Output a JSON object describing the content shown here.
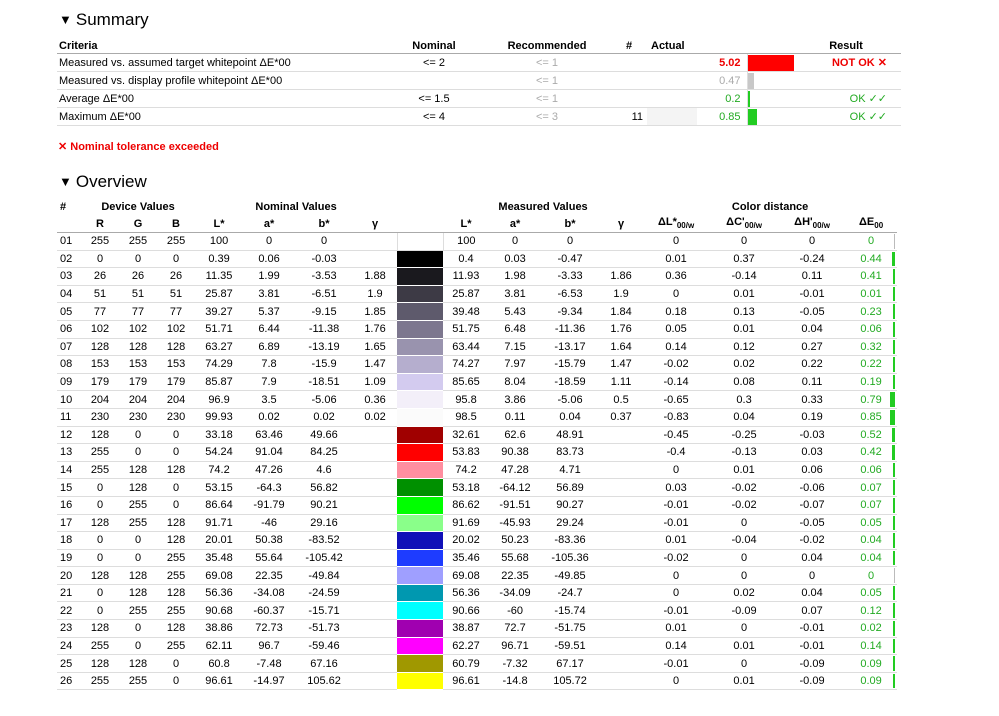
{
  "summary": {
    "title": "Summary",
    "headers": {
      "criteria": "Criteria",
      "nominal": "Nominal",
      "recommended": "Recommended",
      "count": "#",
      "actual": "Actual",
      "result": "Result"
    },
    "rows": [
      {
        "criteria": "Measured vs. assumed target whitepoint ΔE*00",
        "nominal": "<= 2",
        "recommended": "<= 1",
        "count": "",
        "actual": "5.02",
        "actual_status": "bad",
        "bar_fraction": 1.0,
        "bar_color": "#ff0000",
        "result": "NOT OK ✕",
        "result_status": "bad"
      },
      {
        "criteria": "Measured vs. display profile whitepoint ΔE*00",
        "nominal": "",
        "recommended": "<= 1",
        "count": "",
        "actual": "0.47",
        "actual_status": "gray",
        "bar_fraction": 0.12,
        "bar_color": "#c8c8c8",
        "result": "",
        "result_status": ""
      },
      {
        "criteria": "Average ΔE*00",
        "nominal": "<= 1.5",
        "recommended": "<= 1",
        "count": "",
        "actual": "0.2",
        "actual_status": "ok",
        "bar_fraction": 0.05,
        "bar_color": "#22cc22",
        "result": "OK ✓✓",
        "result_status": "ok"
      },
      {
        "criteria": "Maximum ΔE*00",
        "nominal": "<= 4",
        "recommended": "<= 3",
        "count": "11",
        "actual": "0.85",
        "actual_status": "ok",
        "bar_fraction": 0.2,
        "bar_color": "#22cc22",
        "result": "OK ✓✓",
        "result_status": "ok"
      }
    ],
    "warning": "✕ Nominal tolerance exceeded"
  },
  "overview": {
    "title": "Overview",
    "group_headers": {
      "num": "#",
      "device": "Device Values",
      "nominal": "Nominal Values",
      "measured": "Measured Values",
      "distance": "Color distance"
    },
    "col_headers": [
      "R",
      "G",
      "B",
      "L*",
      "a*",
      "b*",
      "γ",
      "L*",
      "a*",
      "b*",
      "γ"
    ],
    "distance_headers": {
      "dl_main": "ΔL*",
      "dc_main": "ΔC'",
      "dh_main": "ΔH'",
      "sub": "00/w",
      "de_main": "ΔE",
      "de_sub": "00"
    },
    "rows": [
      {
        "n": "01",
        "r": "255",
        "g": "255",
        "b": "255",
        "nl": "100",
        "na": "0",
        "nb": "0",
        "ng": "",
        "sw": "#ffffff",
        "ml": "100",
        "ma": "0",
        "mb": "0",
        "mg": "",
        "dl": "0",
        "dc": "0",
        "dh": "0",
        "de": "0",
        "dev": 0
      },
      {
        "n": "02",
        "r": "0",
        "g": "0",
        "b": "0",
        "nl": "0.39",
        "na": "0.06",
        "nb": "-0.03",
        "ng": "",
        "sw": "#000000",
        "ml": "0.4",
        "ma": "0.03",
        "mb": "-0.47",
        "mg": "",
        "dl": "0.01",
        "dc": "0.37",
        "dh": "-0.24",
        "de": "0.44",
        "dev": 0.44
      },
      {
        "n": "03",
        "r": "26",
        "g": "26",
        "b": "26",
        "nl": "11.35",
        "na": "1.99",
        "nb": "-3.53",
        "ng": "1.88",
        "sw": "#1a191e",
        "ml": "11.93",
        "ma": "1.98",
        "mb": "-3.33",
        "mg": "1.86",
        "dl": "0.36",
        "dc": "-0.14",
        "dh": "0.11",
        "de": "0.41",
        "dev": 0.41
      },
      {
        "n": "04",
        "r": "51",
        "g": "51",
        "b": "51",
        "nl": "25.87",
        "na": "3.81",
        "nb": "-6.51",
        "ng": "1.9",
        "sw": "#3d3a45",
        "ml": "25.87",
        "ma": "3.81",
        "mb": "-6.53",
        "mg": "1.9",
        "dl": "0",
        "dc": "0.01",
        "dh": "-0.01",
        "de": "0.01",
        "dev": 0.01
      },
      {
        "n": "05",
        "r": "77",
        "g": "77",
        "b": "77",
        "nl": "39.27",
        "na": "5.37",
        "nb": "-9.15",
        "ng": "1.85",
        "sw": "#5e5a6c",
        "ml": "39.48",
        "ma": "5.43",
        "mb": "-9.34",
        "mg": "1.84",
        "dl": "0.18",
        "dc": "0.13",
        "dh": "-0.05",
        "de": "0.23",
        "dev": 0.23
      },
      {
        "n": "06",
        "r": "102",
        "g": "102",
        "b": "102",
        "nl": "51.71",
        "na": "6.44",
        "nb": "-11.38",
        "ng": "1.76",
        "sw": "#7d778f",
        "ml": "51.75",
        "ma": "6.48",
        "mb": "-11.36",
        "mg": "1.76",
        "dl": "0.05",
        "dc": "0.01",
        "dh": "0.04",
        "de": "0.06",
        "dev": 0.06
      },
      {
        "n": "07",
        "r": "128",
        "g": "128",
        "b": "128",
        "nl": "63.27",
        "na": "6.89",
        "nb": "-13.19",
        "ng": "1.65",
        "sw": "#9993ae",
        "ml": "63.44",
        "ma": "7.15",
        "mb": "-13.17",
        "mg": "1.64",
        "dl": "0.14",
        "dc": "0.12",
        "dh": "0.27",
        "de": "0.32",
        "dev": 0.32
      },
      {
        "n": "08",
        "r": "153",
        "g": "153",
        "b": "153",
        "nl": "74.29",
        "na": "7.8",
        "nb": "-15.9",
        "ng": "1.47",
        "sw": "#b5aece",
        "ml": "74.27",
        "ma": "7.97",
        "mb": "-15.79",
        "mg": "1.47",
        "dl": "-0.02",
        "dc": "0.02",
        "dh": "0.22",
        "de": "0.22",
        "dev": 0.22
      },
      {
        "n": "09",
        "r": "179",
        "g": "179",
        "b": "179",
        "nl": "85.87",
        "na": "7.9",
        "nb": "-18.51",
        "ng": "1.09",
        "sw": "#d3cbef",
        "ml": "85.65",
        "ma": "8.04",
        "mb": "-18.59",
        "mg": "1.11",
        "dl": "-0.14",
        "dc": "0.08",
        "dh": "0.11",
        "de": "0.19",
        "dev": 0.19
      },
      {
        "n": "10",
        "r": "204",
        "g": "204",
        "b": "204",
        "nl": "96.9",
        "na": "3.5",
        "nb": "-5.06",
        "ng": "0.36",
        "sw": "#f3eff9",
        "ml": "95.8",
        "ma": "3.86",
        "mb": "-5.06",
        "mg": "0.5",
        "dl": "-0.65",
        "dc": "0.3",
        "dh": "0.33",
        "de": "0.79",
        "dev": 0.79
      },
      {
        "n": "11",
        "r": "230",
        "g": "230",
        "b": "230",
        "nl": "99.93",
        "na": "0.02",
        "nb": "0.02",
        "ng": "0.02",
        "sw": "#fbfbfb",
        "ml": "98.5",
        "ma": "0.11",
        "mb": "0.04",
        "mg": "0.37",
        "dl": "-0.83",
        "dc": "0.04",
        "dh": "0.19",
        "de": "0.85",
        "dev": 0.85
      },
      {
        "n": "12",
        "r": "128",
        "g": "0",
        "b": "0",
        "nl": "33.18",
        "na": "63.46",
        "nb": "49.66",
        "ng": "",
        "sw": "#a00000",
        "ml": "32.61",
        "ma": "62.6",
        "mb": "48.91",
        "mg": "",
        "dl": "-0.45",
        "dc": "-0.25",
        "dh": "-0.03",
        "de": "0.52",
        "dev": 0.52
      },
      {
        "n": "13",
        "r": "255",
        "g": "0",
        "b": "0",
        "nl": "54.24",
        "na": "91.04",
        "nb": "84.25",
        "ng": "",
        "sw": "#ff0000",
        "ml": "53.83",
        "ma": "90.38",
        "mb": "83.73",
        "mg": "",
        "dl": "-0.4",
        "dc": "-0.13",
        "dh": "0.03",
        "de": "0.42",
        "dev": 0.42
      },
      {
        "n": "14",
        "r": "255",
        "g": "128",
        "b": "128",
        "nl": "74.2",
        "na": "47.26",
        "nb": "4.6",
        "ng": "",
        "sw": "#ff8fa0",
        "ml": "74.2",
        "ma": "47.28",
        "mb": "4.71",
        "mg": "",
        "dl": "0",
        "dc": "0.01",
        "dh": "0.06",
        "de": "0.06",
        "dev": 0.06
      },
      {
        "n": "15",
        "r": "0",
        "g": "128",
        "b": "0",
        "nl": "53.15",
        "na": "-64.3",
        "nb": "56.82",
        "ng": "",
        "sw": "#009000",
        "ml": "53.18",
        "ma": "-64.12",
        "mb": "56.89",
        "mg": "",
        "dl": "0.03",
        "dc": "-0.02",
        "dh": "-0.06",
        "de": "0.07",
        "dev": 0.07
      },
      {
        "n": "16",
        "r": "0",
        "g": "255",
        "b": "0",
        "nl": "86.64",
        "na": "-91.79",
        "nb": "90.21",
        "ng": "",
        "sw": "#00ff00",
        "ml": "86.62",
        "ma": "-91.51",
        "mb": "90.27",
        "mg": "",
        "dl": "-0.01",
        "dc": "-0.02",
        "dh": "-0.07",
        "de": "0.07",
        "dev": 0.07
      },
      {
        "n": "17",
        "r": "128",
        "g": "255",
        "b": "128",
        "nl": "91.71",
        "na": "-46",
        "nb": "29.16",
        "ng": "",
        "sw": "#8aff8a",
        "ml": "91.69",
        "ma": "-45.93",
        "mb": "29.24",
        "mg": "",
        "dl": "-0.01",
        "dc": "0",
        "dh": "-0.05",
        "de": "0.05",
        "dev": 0.05
      },
      {
        "n": "18",
        "r": "0",
        "g": "0",
        "b": "128",
        "nl": "20.01",
        "na": "50.38",
        "nb": "-83.52",
        "ng": "",
        "sw": "#1010b8",
        "ml": "20.02",
        "ma": "50.23",
        "mb": "-83.36",
        "mg": "",
        "dl": "0.01",
        "dc": "-0.04",
        "dh": "-0.02",
        "de": "0.04",
        "dev": 0.04
      },
      {
        "n": "19",
        "r": "0",
        "g": "0",
        "b": "255",
        "nl": "35.48",
        "na": "55.64",
        "nb": "-105.42",
        "ng": "",
        "sw": "#1e3cff",
        "ml": "35.46",
        "ma": "55.68",
        "mb": "-105.36",
        "mg": "",
        "dl": "-0.02",
        "dc": "0",
        "dh": "0.04",
        "de": "0.04",
        "dev": 0.04
      },
      {
        "n": "20",
        "r": "128",
        "g": "128",
        "b": "255",
        "nl": "69.08",
        "na": "22.35",
        "nb": "-49.84",
        "ng": "",
        "sw": "#9f9fff",
        "ml": "69.08",
        "ma": "22.35",
        "mb": "-49.85",
        "mg": "",
        "dl": "0",
        "dc": "0",
        "dh": "0",
        "de": "0",
        "dev": 0
      },
      {
        "n": "21",
        "r": "0",
        "g": "128",
        "b": "128",
        "nl": "56.36",
        "na": "-34.08",
        "nb": "-24.59",
        "ng": "",
        "sw": "#0098b0",
        "ml": "56.36",
        "ma": "-34.09",
        "mb": "-24.7",
        "mg": "",
        "dl": "0",
        "dc": "0.02",
        "dh": "0.04",
        "de": "0.05",
        "dev": 0.05
      },
      {
        "n": "22",
        "r": "0",
        "g": "255",
        "b": "255",
        "nl": "90.68",
        "na": "-60.37",
        "nb": "-15.71",
        "ng": "",
        "sw": "#00ffff",
        "ml": "90.66",
        "ma": "-60",
        "mb": "-15.74",
        "mg": "",
        "dl": "-0.01",
        "dc": "-0.09",
        "dh": "0.07",
        "de": "0.12",
        "dev": 0.12
      },
      {
        "n": "23",
        "r": "128",
        "g": "0",
        "b": "128",
        "nl": "38.86",
        "na": "72.73",
        "nb": "-51.73",
        "ng": "",
        "sw": "#a000b0",
        "ml": "38.87",
        "ma": "72.7",
        "mb": "-51.75",
        "mg": "",
        "dl": "0.01",
        "dc": "0",
        "dh": "-0.01",
        "de": "0.02",
        "dev": 0.02
      },
      {
        "n": "24",
        "r": "255",
        "g": "0",
        "b": "255",
        "nl": "62.11",
        "na": "96.7",
        "nb": "-59.46",
        "ng": "",
        "sw": "#ff00ff",
        "ml": "62.27",
        "ma": "96.71",
        "mb": "-59.51",
        "mg": "",
        "dl": "0.14",
        "dc": "0.01",
        "dh": "-0.01",
        "de": "0.14",
        "dev": 0.14
      },
      {
        "n": "25",
        "r": "128",
        "g": "128",
        "b": "0",
        "nl": "60.8",
        "na": "-7.48",
        "nb": "67.16",
        "ng": "",
        "sw": "#a09800",
        "ml": "60.79",
        "ma": "-7.32",
        "mb": "67.17",
        "mg": "",
        "dl": "-0.01",
        "dc": "0",
        "dh": "-0.09",
        "de": "0.09",
        "dev": 0.09
      },
      {
        "n": "26",
        "r": "255",
        "g": "255",
        "b": "0",
        "nl": "96.61",
        "na": "-14.97",
        "nb": "105.62",
        "ng": "",
        "sw": "#ffff00",
        "ml": "96.61",
        "ma": "-14.8",
        "mb": "105.72",
        "mg": "",
        "dl": "0",
        "dc": "0.01",
        "dh": "-0.09",
        "de": "0.09",
        "dev": 0.09
      }
    ]
  }
}
